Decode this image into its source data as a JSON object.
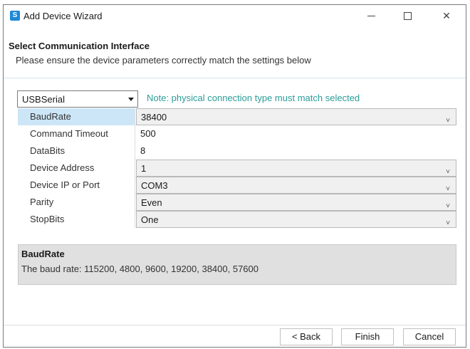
{
  "window": {
    "title": "Add Device Wizard",
    "app_icon_glyph": "S",
    "controls": {
      "close_glyph": "✕"
    }
  },
  "header": {
    "title": "Select Communication Interface",
    "subtitle": "Please ensure the device parameters correctly match the settings below"
  },
  "interface": {
    "selected": "USBSerial",
    "note": "Note: physical connection type must match selected"
  },
  "properties": [
    {
      "name": "BaudRate",
      "value": "38400",
      "dropdown": true,
      "selected": true
    },
    {
      "name": "Command Timeout",
      "value": "500",
      "dropdown": false,
      "selected": false
    },
    {
      "name": "DataBits",
      "value": "8",
      "dropdown": false,
      "selected": false
    },
    {
      "name": "Device Address",
      "value": "1",
      "dropdown": true,
      "selected": false
    },
    {
      "name": "Device IP or Port",
      "value": "COM3",
      "dropdown": true,
      "selected": false
    },
    {
      "name": "Parity",
      "value": "Even",
      "dropdown": true,
      "selected": false
    },
    {
      "name": "StopBits",
      "value": "One",
      "dropdown": true,
      "selected": false
    }
  ],
  "description": {
    "title": "BaudRate",
    "text": "The baud rate: 115200, 4800, 9600, 19200, 38400, 57600"
  },
  "buttons": {
    "back": "< Back",
    "finish": "Finish",
    "cancel": "Cancel"
  },
  "colors": {
    "accent_teal": "#2a9d97",
    "selection": "#cde6f7",
    "app_icon": "#1e88d8"
  }
}
